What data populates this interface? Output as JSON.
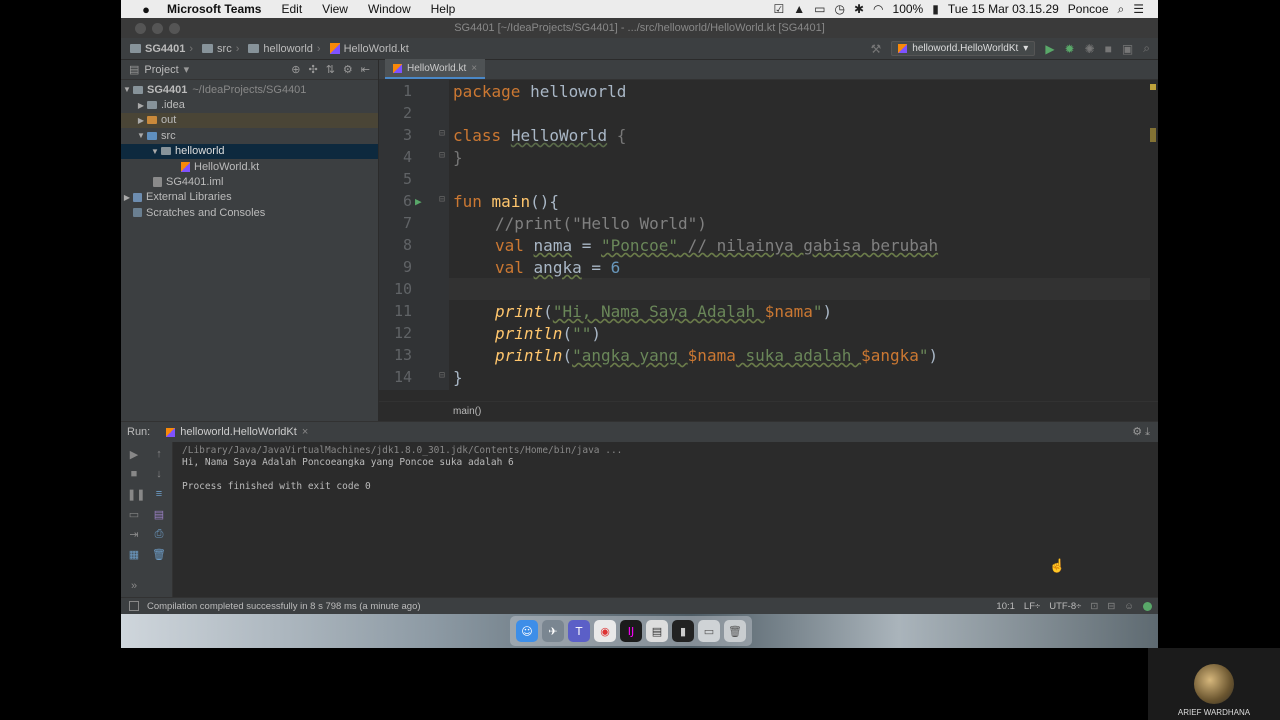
{
  "menubar": {
    "apple": "",
    "app_name": "Microsoft Teams",
    "items": [
      "Edit",
      "View",
      "Window",
      "Help"
    ],
    "battery": "100%",
    "datetime": "Tue 15 Mar  03.15.29",
    "user": "Poncoe"
  },
  "window": {
    "title": "SG4401 [~/IdeaProjects/SG4401] - .../src/helloworld/HelloWorld.kt [SG4401]"
  },
  "navbar": {
    "crumbs": [
      "SG4401",
      "src",
      "helloworld",
      "HelloWorld.kt"
    ],
    "run_config": "helloworld.HelloWorldKt"
  },
  "project": {
    "header": "Project",
    "tree": [
      {
        "label": "SG4401",
        "extra": "~/IdeaProjects/SG4401",
        "depth": 0,
        "expanded": true,
        "kind": "folder"
      },
      {
        "label": ".idea",
        "depth": 1,
        "expanded": false,
        "kind": "folder"
      },
      {
        "label": "out",
        "depth": 1,
        "expanded": false,
        "kind": "folder-out"
      },
      {
        "label": "src",
        "depth": 1,
        "expanded": true,
        "kind": "folder-src"
      },
      {
        "label": "helloworld",
        "depth": 2,
        "expanded": true,
        "kind": "package",
        "selected": true
      },
      {
        "label": "HelloWorld.kt",
        "depth": 3,
        "kind": "kt"
      },
      {
        "label": "SG4401.iml",
        "depth": 1,
        "kind": "iml"
      },
      {
        "label": "External Libraries",
        "depth": 0,
        "expanded": false,
        "kind": "lib"
      },
      {
        "label": "Scratches and Consoles",
        "depth": 0,
        "kind": "scratch"
      }
    ]
  },
  "editor": {
    "tab": "HelloWorld.kt",
    "line_numbers": [
      "1",
      "2",
      "3",
      "4",
      "5",
      "6",
      "7",
      "8",
      "9",
      "10",
      "11",
      "12",
      "13",
      "14"
    ],
    "lines": {
      "l1_kw": "package",
      "l1_rest": " helloworld",
      "l3_kw": "class",
      "l3_name": "HelloWorld",
      "l3_rest": " {",
      "l4": "}",
      "l6_kw": "fun",
      "l6_fn": "main",
      "l6_rest": "(){",
      "l7": "//print(\"Hello World\")",
      "l8_kw": "val",
      "l8_var": "nama",
      "l8_eq": " = ",
      "l8_str": "\"Poncoe\"",
      "l8_cmt": " // nilainya gabisa berubah",
      "l9_kw": "val",
      "l9_var": "angka",
      "l9_eq": " = ",
      "l9_num": "6",
      "l11_fn": "print",
      "l11_a": "(",
      "l11_str1": "\"Hi, Nama Saya Adalah ",
      "l11_tpl": "$nama",
      "l11_str2": "\"",
      "l11_b": ")",
      "l12_fn": "println",
      "l12_a": "(",
      "l12_str": "\"\"",
      "l12_b": ")",
      "l13_fn": "println",
      "l13_a": "(",
      "l13_str1": "\"angka yang ",
      "l13_tpl1": "$nama",
      "l13_str2": " suka adalah ",
      "l13_tpl2": "$angka",
      "l13_str3": "\"",
      "l13_b": ")",
      "l14": "}"
    },
    "breadcrumb": "main()"
  },
  "run": {
    "label": "Run:",
    "tab": "helloworld.HelloWorldKt",
    "output": [
      "/Library/Java/JavaVirtualMachines/jdk1.8.0_301.jdk/Contents/Home/bin/java ...",
      "Hi, Nama Saya Adalah Poncoeangka yang Poncoe suka adalah 6",
      "",
      "Process finished with exit code 0"
    ]
  },
  "status": {
    "message": "Compilation completed successfully in 8 s 798 ms (a minute ago)",
    "position": "10:1",
    "line_sep": "LF÷",
    "encoding": "UTF-8÷"
  },
  "video_tile": {
    "name": "ARIEF WARDHANA"
  },
  "colors": {
    "keyword": "#cc7832",
    "string": "#6a8759",
    "function": "#ffc66d",
    "number": "#6897bb",
    "comment": "#808080",
    "editor_bg": "#2b2b2b",
    "panel_bg": "#3c3f41"
  }
}
